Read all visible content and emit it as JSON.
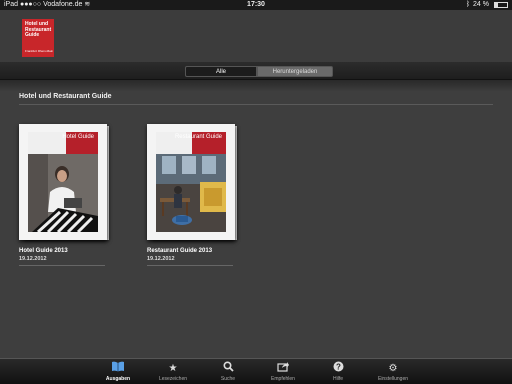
{
  "status": {
    "carrier": "iPad",
    "network": "Vodafone.de",
    "time": "17:30",
    "battery": "24 %",
    "battery_level": 0.24
  },
  "logo": {
    "line1": "Hotel und",
    "line2": "Restaurant",
    "line3": "Guide",
    "tagline": "Frankfurt Rhein-Main"
  },
  "segments": {
    "all": "Alle",
    "downloaded": "Heruntergeladen"
  },
  "section_title": "Hotel und Restaurant Guide",
  "books": [
    {
      "title": "Hotel Guide 2013",
      "date": "19.12.2012",
      "cover_label": "Hotel Guide"
    },
    {
      "title": "Restaurant Guide 2013",
      "date": "19.12.2012",
      "cover_label": "Restaurant Guide"
    }
  ],
  "tabs": [
    {
      "label": "Ausgaben",
      "icon": "book-icon"
    },
    {
      "label": "Lesezeichen",
      "icon": "bookmark-star-icon"
    },
    {
      "label": "Suche",
      "icon": "search-icon"
    },
    {
      "label": "Empfehlen",
      "icon": "share-icon"
    },
    {
      "label": "Hilfe",
      "icon": "help-icon"
    },
    {
      "label": "Einstellungen",
      "icon": "gear-icon"
    }
  ],
  "colors": {
    "brand_red": "#c8262a",
    "active_tab": "#5aa0e6"
  }
}
